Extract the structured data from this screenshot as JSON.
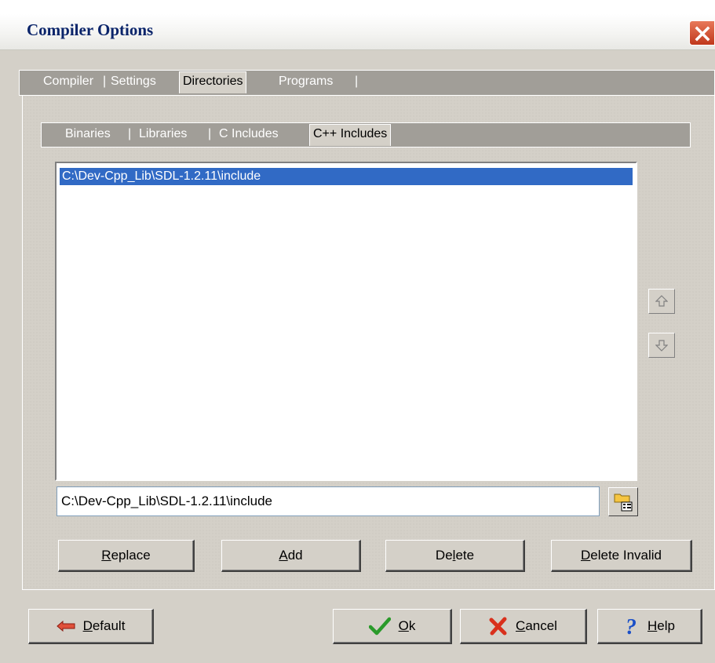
{
  "window": {
    "title": "Compiler Options"
  },
  "outer_tabs": [
    {
      "label": "Compiler",
      "active": false
    },
    {
      "label": "Settings",
      "active": false
    },
    {
      "label": "Directories",
      "active": true
    },
    {
      "label": "Programs",
      "active": false
    }
  ],
  "inner_tabs": [
    {
      "label": "Binaries",
      "active": false
    },
    {
      "label": "Libraries",
      "active": false
    },
    {
      "label": "C Includes",
      "active": false
    },
    {
      "label": "C++ Includes",
      "active": true
    }
  ],
  "directory_list": {
    "items": [
      {
        "path": "C:\\Dev-Cpp_Lib\\SDL-1.2.11\\include",
        "selected": true
      }
    ]
  },
  "path_field": {
    "value": "C:\\Dev-Cpp_Lib\\SDL-1.2.11\\include"
  },
  "actions": {
    "replace": {
      "mnemonic": "R",
      "rest": "eplace"
    },
    "add": {
      "mnemonic": "A",
      "rest": "dd"
    },
    "delete": {
      "pre": "De",
      "mnemonic": "l",
      "rest": "ete"
    },
    "delete_invalid": {
      "mnemonic": "D",
      "rest": "elete Invalid"
    }
  },
  "footer": {
    "default": {
      "mnemonic": "D",
      "rest": "efault"
    },
    "ok": {
      "mnemonic": "O",
      "rest": "k"
    },
    "cancel": {
      "mnemonic": "C",
      "rest": "ancel"
    },
    "help": {
      "mnemonic": "H",
      "rest": "elp"
    }
  },
  "colors": {
    "selection": "#316ac5",
    "title_text": "#0a246a",
    "face": "#d4d0c8",
    "close": "#d9542e"
  }
}
